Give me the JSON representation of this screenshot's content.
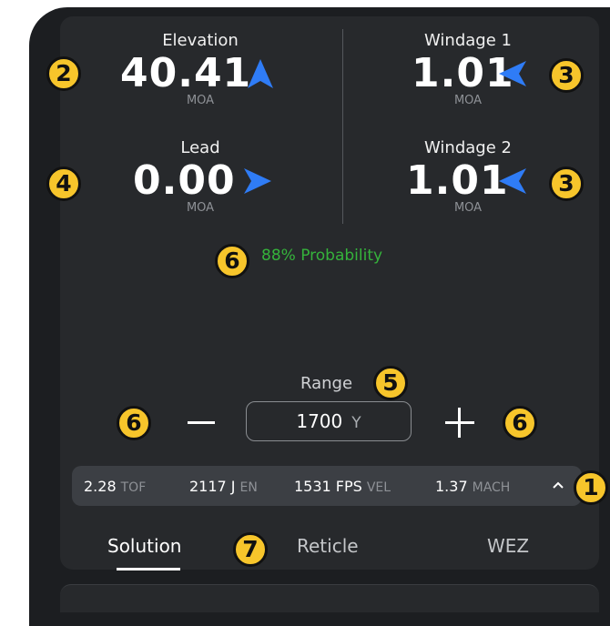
{
  "elevation": {
    "label": "Elevation",
    "value": "40.41",
    "unit": "MOA",
    "arrow": "up"
  },
  "windage1": {
    "label": "Windage 1",
    "value": "1.01",
    "unit": "MOA",
    "arrow": "left"
  },
  "lead": {
    "label": "Lead",
    "value": "0.00",
    "unit": "MOA",
    "arrow": "right"
  },
  "windage2": {
    "label": "Windage 2",
    "value": "1.01",
    "unit": "MOA",
    "arrow": "left"
  },
  "probability": "88% Probability",
  "range": {
    "label": "Range",
    "value": "1700",
    "unit": "Y"
  },
  "stats": [
    {
      "value": "2.28",
      "key": "TOF"
    },
    {
      "value": "2117 J",
      "key": "EN"
    },
    {
      "value": "1531 FPS",
      "key": "VEL"
    },
    {
      "value": "1.37",
      "key": "MACH"
    }
  ],
  "tabs": [
    "Solution",
    "Reticle",
    "WEZ"
  ],
  "active_tab": "Solution",
  "badges": {
    "elevation": "2",
    "windage1": "3",
    "lead": "4",
    "windage2": "3",
    "probability": "6",
    "range": "5",
    "minus": "6",
    "plus": "6",
    "strip": "1",
    "tabs": "7"
  },
  "colors": {
    "arrow": "#2f7cf6",
    "probability": "#35b33b",
    "badge": "#f7c52b"
  },
  "icons": {
    "up": "arrow-up-icon",
    "left": "arrow-left-icon",
    "right": "arrow-right-icon",
    "expand": "chevron-up-icon"
  }
}
